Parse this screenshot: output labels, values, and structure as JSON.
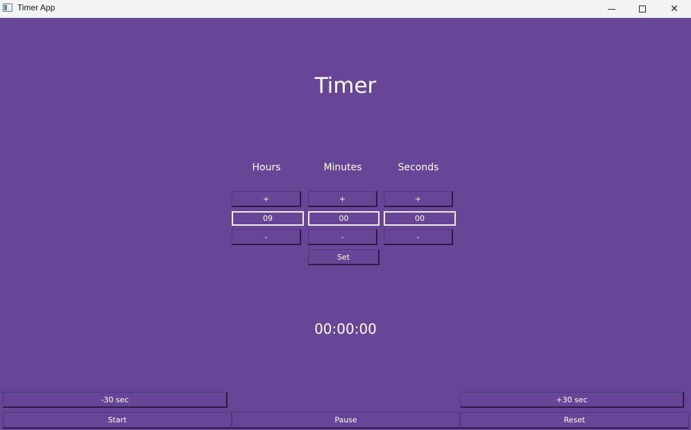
{
  "window": {
    "title": "Timer App",
    "icon": "app-window-icon",
    "controls": {
      "minimize": "minimize-icon",
      "maximize": "maximize-icon",
      "close": "✕"
    }
  },
  "main": {
    "title": "Timer",
    "columns": [
      {
        "label": "Hours",
        "increment": "+",
        "value": "09",
        "decrement": "-"
      },
      {
        "label": "Minutes",
        "increment": "+",
        "value": "00",
        "decrement": "-"
      },
      {
        "label": "Seconds",
        "increment": "+",
        "value": "00",
        "decrement": "-"
      }
    ],
    "set_label": "Set",
    "countdown": "00:00:00"
  },
  "controls": {
    "minus30": "-30 sec",
    "plus30": "+30 sec",
    "start": "Start",
    "pause": "Pause",
    "reset": "Reset"
  },
  "colors": {
    "background": "#674698",
    "text": "#ffffff",
    "titlebar": "#f2f4f3"
  }
}
